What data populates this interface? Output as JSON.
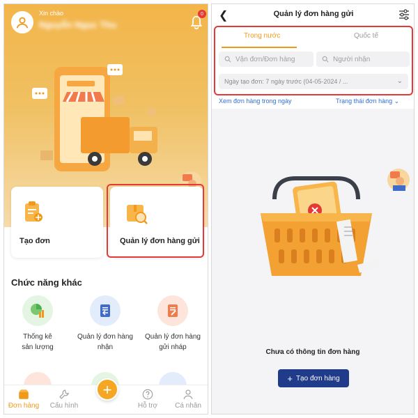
{
  "left": {
    "greeting": "Xin chào",
    "user_name": "Nguyễn Ngọc Thu",
    "notification_count": "0",
    "cards": [
      {
        "label": "Tạo đơn"
      },
      {
        "label": "Quản lý đơn hàng gửi"
      }
    ],
    "section_title": "Chức năng khác",
    "features": [
      {
        "line1": "Thống kê",
        "line2": "sản lượng"
      },
      {
        "line1": "Quản lý đơn hàng",
        "line2": "nhận"
      },
      {
        "line1": "Quản lý đơn hàng",
        "line2": "gửi nháp"
      }
    ],
    "tabbar": [
      {
        "label": "Đơn hàng",
        "active": true
      },
      {
        "label": "Cấu hình",
        "active": false
      },
      {
        "label": "Hỗ trợ",
        "active": false
      },
      {
        "label": "Cá nhân",
        "active": false
      }
    ]
  },
  "right": {
    "title": "Quản lý đơn hàng gửi",
    "tabs": [
      {
        "label": "Trong nước",
        "active": true
      },
      {
        "label": "Quốc tế",
        "active": false
      }
    ],
    "search_waybill_placeholder": "Vận đơn/Đơn hàng",
    "search_receiver_placeholder": "Người nhận",
    "date_filter": "Ngày tạo đơn: 7 ngày trước (04-05-2024 / ...",
    "link_view_orders": "Xem đơn hàng trong ngày",
    "link_order_status": "Trạng thái đơn hàng",
    "empty_message": "Chưa có thông tin đơn hàng",
    "create_button": "Tạo đơn hàng"
  },
  "colors": {
    "accent_orange": "#f19a1a",
    "highlight_red": "#e53935",
    "primary_navy": "#1f3b8a",
    "link_blue": "#2f6fd6"
  }
}
